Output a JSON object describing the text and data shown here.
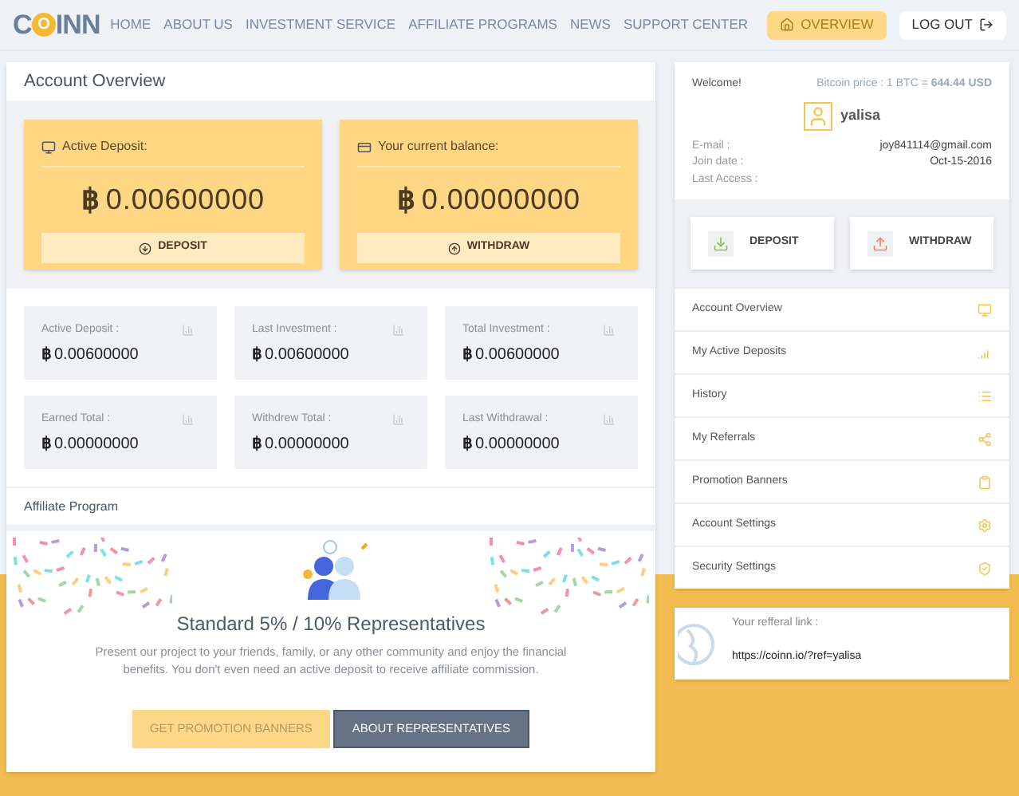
{
  "logo": {
    "parts": [
      "C",
      "O",
      "INN"
    ]
  },
  "nav": {
    "items": [
      {
        "label": "HOME"
      },
      {
        "label": "ABOUT US"
      },
      {
        "label": "INVESTMENT SERVICE"
      },
      {
        "label": "AFFILIATE PROGRAMS"
      },
      {
        "label": "NEWS"
      },
      {
        "label": "SUPPORT CENTER"
      }
    ],
    "overview_button": "OVERVIEW",
    "logout_button": "LOG OUT"
  },
  "overview": {
    "title": "Account Overview",
    "cards": [
      {
        "label": "Active Deposit:",
        "symbol": "฿",
        "amount": "0.00600000",
        "button": "DEPOSIT",
        "kind": "deposit"
      },
      {
        "label": "Your current balance:",
        "symbol": "฿",
        "amount": "0.00000000",
        "button": "WITHDRAW",
        "kind": "withdraw"
      }
    ],
    "stats": [
      {
        "label": "Active Deposit :",
        "symbol": "฿",
        "value": "0.00600000"
      },
      {
        "label": "Last Investment :",
        "symbol": "฿",
        "value": "0.00600000"
      },
      {
        "label": "Total Investment :",
        "symbol": "฿",
        "value": "0.00600000"
      },
      {
        "label": "Earned Total :",
        "symbol": "฿",
        "value": "0.00000000"
      },
      {
        "label": "Withdrew Total :",
        "symbol": "฿",
        "value": "0.00000000"
      },
      {
        "label": "Last Withdrawal :",
        "symbol": "฿",
        "value": "0.00000000"
      }
    ]
  },
  "affiliate": {
    "title": "Affiliate Program",
    "heading": "Standard 5% / 10% Representatives",
    "text": "Present our project to your friends, family, or any other community and enjoy the financial benefits. You don't even need an active deposit to receive affiliate commission.",
    "buttons": [
      {
        "label": "GET PROMOTION BANNERS",
        "kind": "primary"
      },
      {
        "label": "ABOUT REPRESENTATIVES",
        "kind": "dark"
      }
    ]
  },
  "profile": {
    "welcome": "Welcome!",
    "price": "Bitcoin price : 1 BTC = **644.44 USD**",
    "username": "yalisa",
    "fields": [
      {
        "label": "E-mail :",
        "value": "joy841114@gmail.com"
      },
      {
        "label": "Join date :",
        "value": "Oct-15-2016"
      },
      {
        "label": "Last Access :"
      }
    ],
    "actions": [
      {
        "label": "DEPOSIT",
        "kind": "deposit"
      },
      {
        "label": "WITHDRAW",
        "kind": "withdraw"
      }
    ]
  },
  "menu": [
    {
      "label": "Account Overview",
      "kind": "monitor"
    },
    {
      "label": "My Active Deposits",
      "kind": "signal"
    },
    {
      "label": "History",
      "kind": "list"
    },
    {
      "label": "My Referrals",
      "kind": "share"
    },
    {
      "label": "Promotion Banners",
      "kind": "clipboard"
    },
    {
      "label": "Account Settings",
      "kind": "gear"
    },
    {
      "label": "Security Settings",
      "kind": "shield"
    }
  ],
  "referral": {
    "label": "Your refferal link :",
    "link": "https://coinn.io/?ref=yalisa"
  }
}
